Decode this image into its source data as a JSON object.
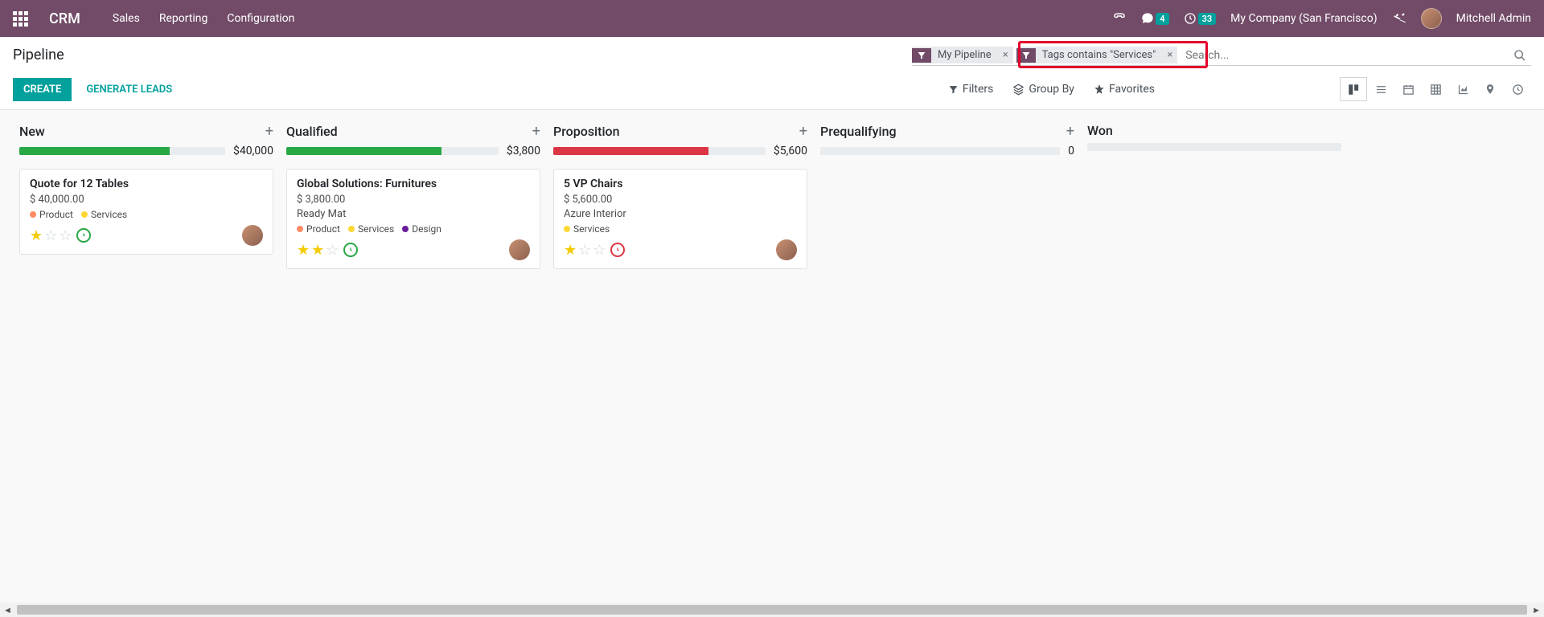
{
  "navbar": {
    "brand": "CRM",
    "menu": [
      "Sales",
      "Reporting",
      "Configuration"
    ],
    "messages_badge": "4",
    "activities_badge": "33",
    "company": "My Company (San Francisco)",
    "user": "Mitchell Admin"
  },
  "breadcrumb": "Pipeline",
  "search": {
    "facets": [
      {
        "label": "My Pipeline"
      },
      {
        "label": "Tags contains \"Services\""
      }
    ],
    "placeholder": "Search..."
  },
  "buttons": {
    "create": "CREATE",
    "generate": "GENERATE LEADS"
  },
  "search_options": {
    "filters": "Filters",
    "groupby": "Group By",
    "favorites": "Favorites"
  },
  "tag_colors": {
    "product": "#ff8a65",
    "services": "#fdd835",
    "design": "#6a1b9a"
  },
  "columns": [
    {
      "title": "New",
      "total": "$40,000",
      "bar_color": "#28a745",
      "bar_fill": 73,
      "cards": [
        {
          "title": "Quote for 12 Tables",
          "amount": "$ 40,000.00",
          "subtitle": "",
          "tags": [
            {
              "name": "Product",
              "color": "#ff8a65"
            },
            {
              "name": "Services",
              "color": "#fdd835"
            }
          ],
          "stars": 1,
          "activity": "green"
        }
      ]
    },
    {
      "title": "Qualified",
      "total": "$3,800",
      "bar_color": "#28a745",
      "bar_fill": 73,
      "cards": [
        {
          "title": "Global Solutions: Furnitures",
          "amount": "$ 3,800.00",
          "subtitle": "Ready Mat",
          "tags": [
            {
              "name": "Product",
              "color": "#ff8a65"
            },
            {
              "name": "Services",
              "color": "#fdd835"
            },
            {
              "name": "Design",
              "color": "#6a1b9a"
            }
          ],
          "stars": 2,
          "activity": "green"
        }
      ]
    },
    {
      "title": "Proposition",
      "total": "$5,600",
      "bar_color": "#dc3545",
      "bar_fill": 73,
      "cards": [
        {
          "title": "5 VP Chairs",
          "amount": "$ 5,600.00",
          "subtitle": "Azure Interior",
          "tags": [
            {
              "name": "Services",
              "color": "#fdd835"
            }
          ],
          "stars": 1,
          "activity": "red"
        }
      ]
    },
    {
      "title": "Prequalifying",
      "total": "0",
      "bar_color": "#e9ecef",
      "bar_fill": 0,
      "cards": []
    },
    {
      "title": "Won",
      "total": "",
      "bar_color": "#e9ecef",
      "bar_fill": 0,
      "cards": [],
      "no_plus": true
    }
  ]
}
